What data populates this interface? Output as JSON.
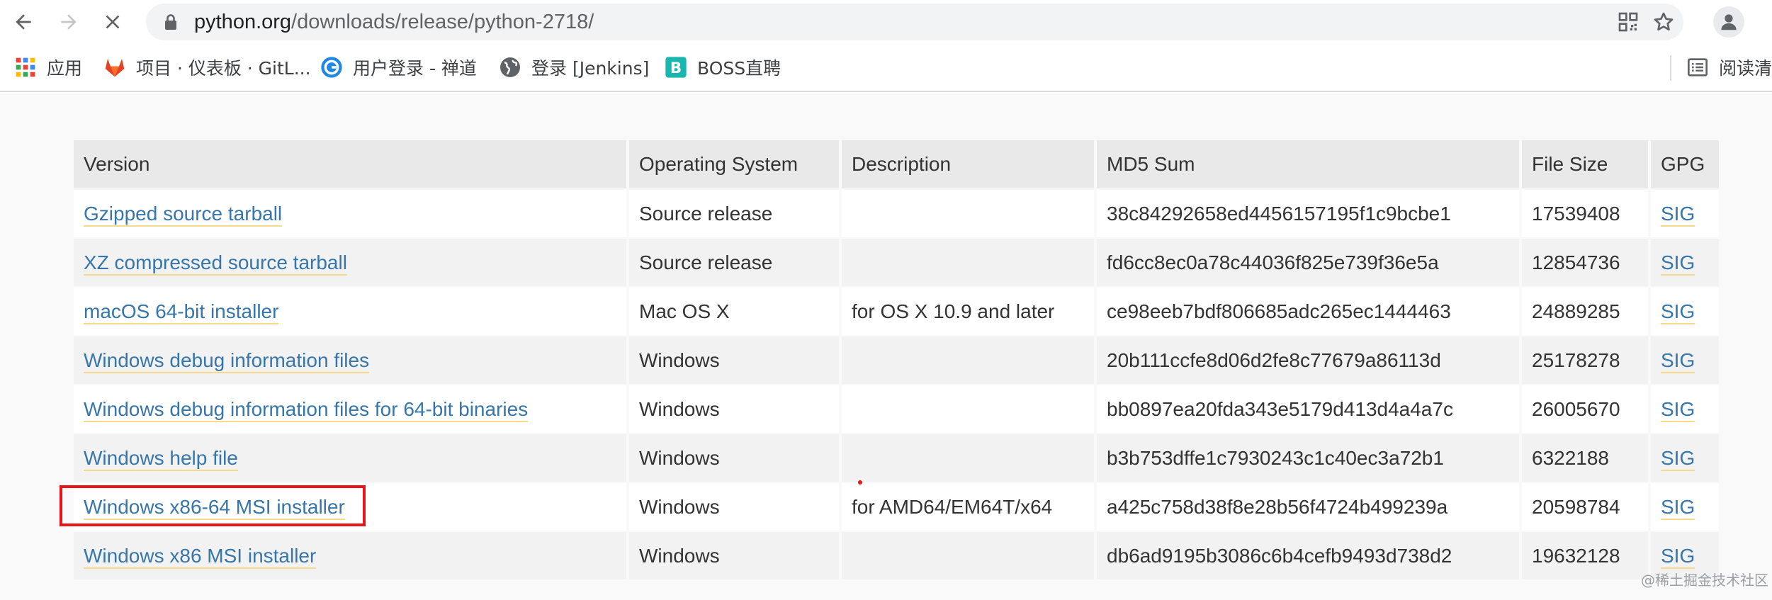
{
  "browser": {
    "url_host": "python.org",
    "url_path": "/downloads/release/python-2718/",
    "bookmarks": [
      {
        "label": "应用",
        "icon": "apps-grid-icon"
      },
      {
        "label": "项目 · 仪表板 · GitL...",
        "icon": "gitlab-icon"
      },
      {
        "label": "用户登录 - 禅道",
        "icon": "zentao-icon"
      },
      {
        "label": "登录 [Jenkins]",
        "icon": "globe-icon"
      },
      {
        "label": "BOSS直聘",
        "icon": "boss-icon"
      }
    ],
    "reading_list_label": "阅读清",
    "colors": {
      "gitlab": "#e24329",
      "zentao": "#1e88e5",
      "boss": "#19b7b0",
      "apps": [
        "#ea4335",
        "#4285f4",
        "#34a853",
        "#fbbc05"
      ]
    }
  },
  "table": {
    "headers": [
      "Version",
      "Operating System",
      "Description",
      "MD5 Sum",
      "File Size",
      "GPG"
    ],
    "rows": [
      {
        "version": "Gzipped source tarball",
        "os": "Source release",
        "description": "",
        "md5": "38c84292658ed4456157195f1c9bcbe1",
        "size": "17539408",
        "gpg": "SIG"
      },
      {
        "version": "XZ compressed source tarball",
        "os": "Source release",
        "description": "",
        "md5": "fd6cc8ec0a78c44036f825e739f36e5a",
        "size": "12854736",
        "gpg": "SIG"
      },
      {
        "version": "macOS 64-bit installer",
        "os": "Mac OS X",
        "description": "for OS X 10.9 and later",
        "md5": "ce98eeb7bdf806685adc265ec1444463",
        "size": "24889285",
        "gpg": "SIG"
      },
      {
        "version": "Windows debug information files",
        "os": "Windows",
        "description": "",
        "md5": "20b111ccfe8d06d2fe8c77679a86113d",
        "size": "25178278",
        "gpg": "SIG"
      },
      {
        "version": "Windows debug information files for 64-bit binaries",
        "os": "Windows",
        "description": "",
        "md5": "bb0897ea20fda343e5179d413d4a4a7c",
        "size": "26005670",
        "gpg": "SIG"
      },
      {
        "version": "Windows help file",
        "os": "Windows",
        "description": "",
        "md5": "b3b753dffe1c7930243c1c40ec3a72b1",
        "size": "6322188",
        "gpg": "SIG"
      },
      {
        "version": "Windows x86-64 MSI installer",
        "os": "Windows",
        "description": "for AMD64/EM64T/x64",
        "md5": "a425c758d38f8e28b56f4724b499239a",
        "size": "20598784",
        "gpg": "SIG"
      },
      {
        "version": "Windows x86 MSI installer",
        "os": "Windows",
        "description": "",
        "md5": "db6ad9195b3086c6b4cefb9493d738d2",
        "size": "19632128",
        "gpg": "SIG"
      }
    ],
    "link_color": "#3776ab",
    "highlight_color": "#e8151b"
  },
  "watermark": "@稀土掘金技术社区"
}
